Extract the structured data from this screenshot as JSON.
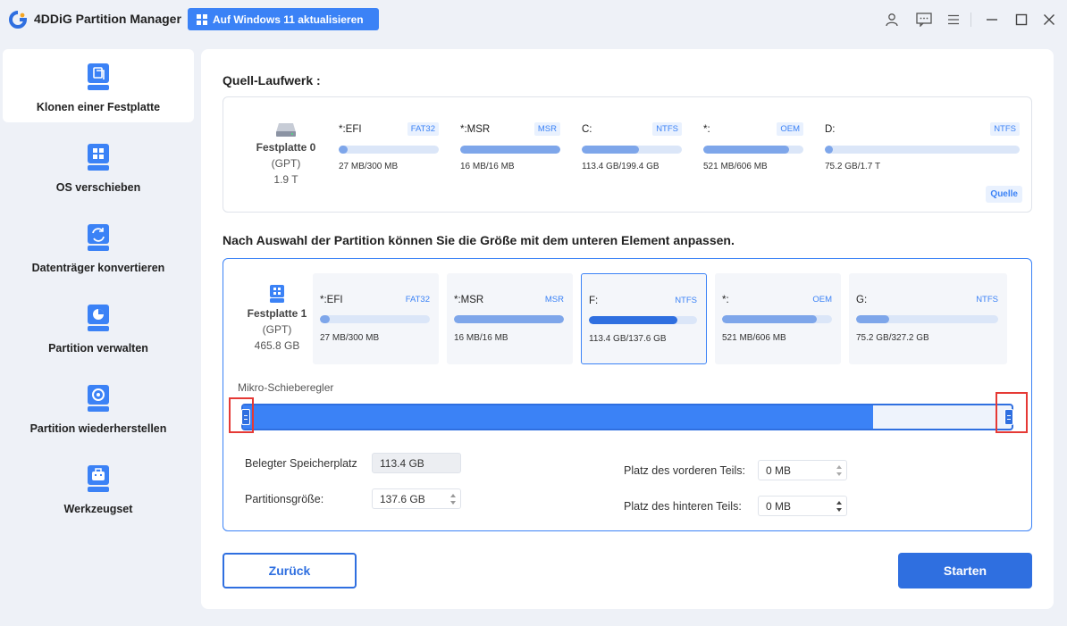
{
  "app": {
    "title": "4DDiG Partition Manager",
    "upgrade_label": "Auf Windows 11 aktualisieren"
  },
  "titlebar_icons": [
    "user-icon",
    "feedback-icon",
    "menu-icon",
    "minimize-icon",
    "maximize-icon",
    "close-icon"
  ],
  "sidebar": {
    "items": [
      {
        "label": "Klonen einer Festplatte",
        "icon": "clone-disk-icon",
        "active": true
      },
      {
        "label": "OS verschieben",
        "icon": "os-migrate-icon",
        "active": false
      },
      {
        "label": "Datenträger konvertieren",
        "icon": "convert-disk-icon",
        "active": false
      },
      {
        "label": "Partition verwalten",
        "icon": "manage-partition-icon",
        "active": false
      },
      {
        "label": "Partition wiederherstellen",
        "icon": "recover-partition-icon",
        "active": false
      },
      {
        "label": "Werkzeugset",
        "icon": "toolkit-icon",
        "active": false
      }
    ]
  },
  "source": {
    "title": "Quell-Laufwerk :",
    "disk": {
      "name": "Festplatte 0",
      "style": "(GPT)",
      "size": "1.9 T"
    },
    "partitions": [
      {
        "name": "*:EFI",
        "fs": "FAT32",
        "usage": "27 MB/300 MB",
        "fill": 0.09
      },
      {
        "name": "*:MSR",
        "fs": "MSR",
        "usage": "16 MB/16 MB",
        "fill": 1.0
      },
      {
        "name": "C:",
        "fs": "NTFS",
        "usage": "113.4 GB/199.4 GB",
        "fill": 0.57
      },
      {
        "name": "*:",
        "fs": "OEM",
        "usage": "521 MB/606 MB",
        "fill": 0.86
      },
      {
        "name": "D:",
        "fs": "NTFS",
        "usage": "75.2 GB/1.7 T",
        "fill": 0.04
      }
    ],
    "badge": "Quelle"
  },
  "target": {
    "title": "Nach Auswahl der Partition können Sie die Größe mit dem unteren Element anpassen.",
    "disk": {
      "name": "Festplatte 1",
      "style": "(GPT)",
      "size": "465.8 GB"
    },
    "partitions": [
      {
        "name": "*:EFI",
        "fs": "FAT32",
        "usage": "27 MB/300 MB",
        "fill": 0.09
      },
      {
        "name": "*:MSR",
        "fs": "MSR",
        "usage": "16 MB/16 MB",
        "fill": 1.0
      },
      {
        "name": "F:",
        "fs": "NTFS",
        "usage": "113.4 GB/137.6 GB",
        "fill": 0.82,
        "selected": true
      },
      {
        "name": "*:",
        "fs": "OEM",
        "usage": "521 MB/606 MB",
        "fill": 0.86
      },
      {
        "name": "G:",
        "fs": "NTFS",
        "usage": "75.2 GB/327.2 GB",
        "fill": 0.23
      }
    ],
    "slider": {
      "label": "Mikro-Schieberegler",
      "fill": 0.82
    },
    "fields": {
      "used_label": "Belegter Speicherplatz",
      "used_value": "113.4 GB",
      "size_label": "Partitionsgröße:",
      "size_value": "137.6  GB",
      "front_label": "Platz des vorderen Teils:",
      "front_value": "0  MB",
      "back_label": "Platz des hinteren Teils:",
      "back_value": "0  MB"
    }
  },
  "buttons": {
    "back": "Zurück",
    "start": "Starten"
  },
  "colors": {
    "accent": "#2f6fe0",
    "highlight": "#e53935"
  }
}
